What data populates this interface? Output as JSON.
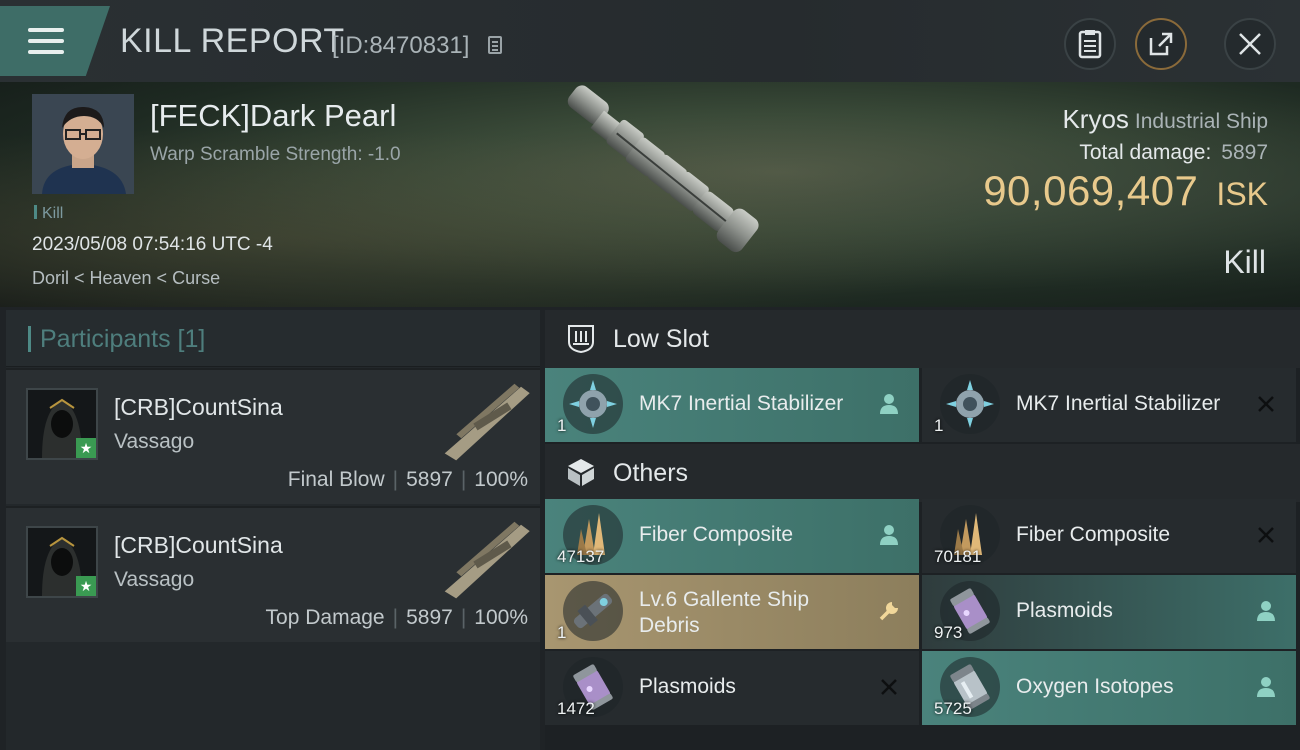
{
  "header": {
    "title": "KILL REPORT",
    "report_id": "[ID:8470831]",
    "menu_icon": "hamburger-icon",
    "buttons": [
      "clipboard-icon",
      "share-icon",
      "close-icon"
    ],
    "accent": "#3e6d67"
  },
  "victim": {
    "name": "[FECK]Dark Pearl",
    "warp_scramble": "Warp Scramble Strength: -1.0",
    "kill_tag": "Kill",
    "datetime": "2023/05/08 07:54:16 UTC -4",
    "location": "Doril < Heaven < Curse",
    "ship_name": "Kryos",
    "ship_class": "Industrial Ship",
    "total_damage_label": "Total damage:",
    "total_damage": "5897",
    "isk_value": "90,069,407",
    "isk_unit": "ISK",
    "result": "Kill",
    "isk_color": "#e8c98c"
  },
  "participants": {
    "header": "Participants [1]",
    "rows": [
      {
        "name": "[CRB]CountSina",
        "ship": "Vassago",
        "role": "Final Blow",
        "damage": "5897",
        "percent": "100%"
      },
      {
        "name": "[CRB]CountSina",
        "ship": "Vassago",
        "role": "Top Damage",
        "damage": "5897",
        "percent": "100%"
      }
    ]
  },
  "sections": {
    "low_slot": "Low Slot",
    "others": "Others"
  },
  "items": [
    {
      "name": "MK7 Inertial Stabilizer",
      "qty": "1",
      "status": "dropped",
      "status_icon": "person-icon"
    },
    {
      "name": "MK7 Inertial Stabilizer",
      "qty": "1",
      "status": "destroyed",
      "status_icon": "x-icon"
    },
    {
      "name": "Fiber Composite",
      "qty": "47137",
      "status": "dropped",
      "status_icon": "person-icon"
    },
    {
      "name": "Fiber Composite",
      "qty": "70181",
      "status": "destroyed",
      "status_icon": "x-icon"
    },
    {
      "name": "Lv.6 Gallente Ship Debris",
      "qty": "1",
      "status": "salvage",
      "status_icon": "wrench-icon"
    },
    {
      "name": "Plasmoids",
      "qty": "973",
      "status": "dropped",
      "status_icon": "person-icon"
    },
    {
      "name": "Plasmoids",
      "qty": "1472",
      "status": "destroyed",
      "status_icon": "x-icon"
    },
    {
      "name": "Oxygen Isotopes",
      "qty": "5725",
      "status": "dropped",
      "status_icon": "person-icon"
    }
  ]
}
